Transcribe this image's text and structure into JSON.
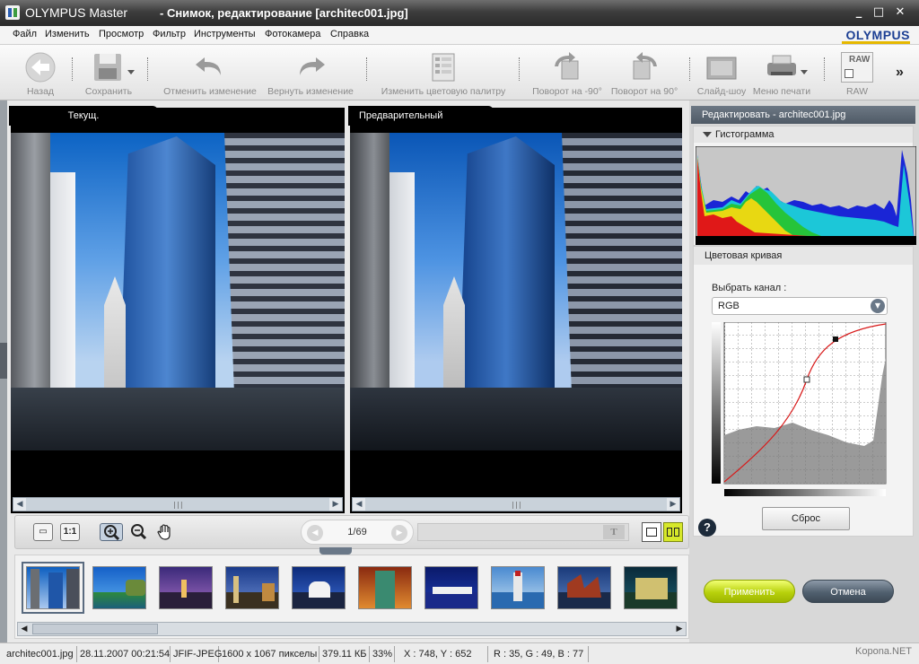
{
  "window": {
    "app_name": "OLYMPUS Master",
    "doc_title": "- Снимок, редактирование [architec001.jpg]",
    "minimize": "_",
    "maximize": "□",
    "close": "✕"
  },
  "menu": {
    "items": [
      "Файл",
      "Изменить",
      "Просмотр",
      "Фильтр",
      "Инструменты",
      "Фотокамера",
      "Справка"
    ],
    "brand": "OLYMPUS"
  },
  "toolbar": {
    "back": "Назад",
    "save": "Сохранить",
    "undo": "Отменить изменение",
    "redo": "Вернуть изменение",
    "palette": "Изменить цветовую палитру",
    "rotate_left": "Поворот на -90°",
    "rotate_right": "Поворот на 90°",
    "slideshow": "Слайд-шоу",
    "print_menu": "Меню печати",
    "raw": "RAW",
    "raw_badge": "RAW",
    "more": "»"
  },
  "views": {
    "current_tab": "Текущ.",
    "preview_tab": "Предварительный просмотр"
  },
  "navigator": {
    "page": "1/69",
    "zoom_fit": "▭",
    "zoom_1to1": "1:1"
  },
  "filmstrip": {
    "count": 10,
    "selected_index": 0
  },
  "edit_panel": {
    "header": "Редактировать - architec001.jpg",
    "histogram_title": "Гистограмма",
    "curve_title": "Цветовая кривая",
    "channel_label": "Выбрать канал :",
    "channel_value": "RGB",
    "reset": "Сброс",
    "help": "?",
    "apply": "Применить",
    "cancel": "Отмена"
  },
  "status": {
    "filename": "architec001.jpg",
    "datetime": "28.11.2007 00:21:54",
    "format": "JFIF-JPEG",
    "dimensions": "1600 x 1067 пикселы",
    "filesize": "379.11 КБ",
    "zoom": "33%",
    "coords": "X : 748, Y : 652",
    "rgb": "R : 35, G : 49, B : 77",
    "watermark": "Kopona.NET"
  },
  "colors": {
    "titlebar": "#3d3d3d",
    "apply_button": "#b8d10c",
    "cancel_button": "#51606f",
    "panel_header": "#5b6672",
    "brand_blue": "#1c3f93"
  }
}
